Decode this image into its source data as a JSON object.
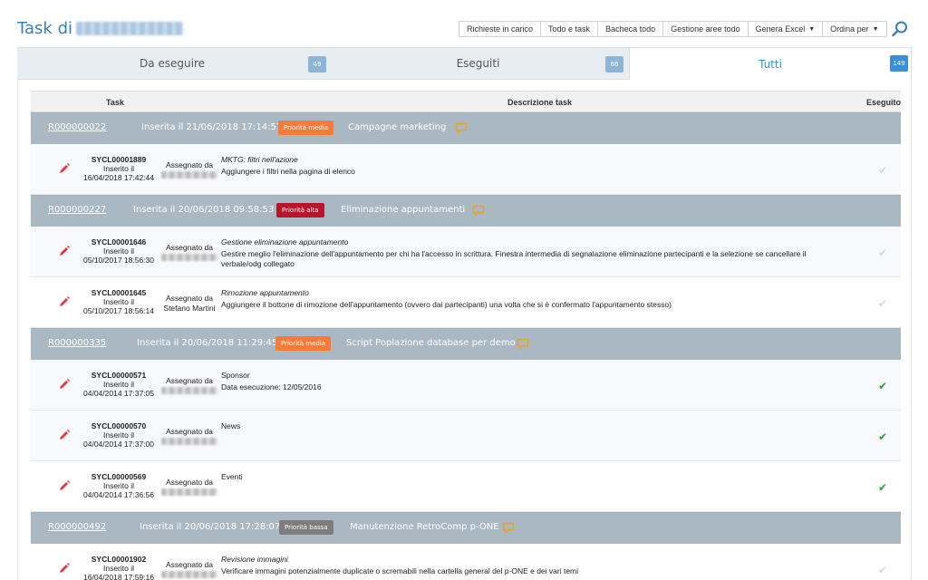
{
  "header": {
    "title_prefix": "Task di",
    "toolbar": [
      {
        "label": "Richieste in carico",
        "dropdown": false
      },
      {
        "label": "Todo e task",
        "dropdown": false
      },
      {
        "label": "Bacheca todo",
        "dropdown": false
      },
      {
        "label": "Gestione aree todo",
        "dropdown": false
      },
      {
        "label": "Genera Excel",
        "dropdown": true
      },
      {
        "label": "Ordina per",
        "dropdown": true
      }
    ],
    "search_icon": "search-icon"
  },
  "tabs": [
    {
      "label": "Da eseguire",
      "count": "49",
      "active": false
    },
    {
      "label": "Eseguiti",
      "count": "66",
      "active": false
    },
    {
      "label": "Tutti",
      "count": "149",
      "active": true
    }
  ],
  "table": {
    "headers": {
      "task": "Task",
      "description": "Descrizione task",
      "done": "Eseguito"
    },
    "groups": [
      {
        "code": "R000000022",
        "inserted": "Inserita il 21/06/2018 17:14:57",
        "priority": "Priorità media",
        "priority_level": "media",
        "title": "Campagne marketing",
        "tasks": [
          {
            "code": "SYCL00001889",
            "inserted_label": "Inserito il",
            "date": "16/04/2018 17:42:44",
            "assigned_label": "Assegnato da",
            "assigned_name": "",
            "desc_title": "MKTG: filtri nell'azione",
            "desc_title_italic": true,
            "desc_text": "Aggiungere i filtri nella pagina di elenco",
            "done": false
          }
        ]
      },
      {
        "code": "R000000227",
        "inserted": "Inserita il 20/06/2018 09:58:53",
        "priority": "Priorità alta",
        "priority_level": "alta",
        "title": "Eliminazione appuntamenti",
        "tasks": [
          {
            "code": "SYCL00001646",
            "inserted_label": "Inserito il",
            "date": "05/10/2017 18:56:30",
            "assigned_label": "Assegnato da",
            "assigned_name": "",
            "desc_title": "Gestione eliminazione appuntamento",
            "desc_title_italic": true,
            "desc_text": "Gestire meglio l'eliminazione dell'appuntamento per chi ha l'accesso in scrittura. Finestra intermedia di segnalazione eliminazione partecipanti e la selezione se cancellare il verbale/odg collegato",
            "done": false
          },
          {
            "code": "SYCL00001645",
            "inserted_label": "Inserito il",
            "date": "05/10/2017 18:56:14",
            "assigned_label": "Assegnato da",
            "assigned_name": "Stefano Martini",
            "desc_title": "Rimozione appuntamento",
            "desc_title_italic": true,
            "desc_text": "Aggiungere il bottone di rimozione dell'appuntamento (ovvero dai partecipanti) una volta che si è confermato l'appuntamento stesso)",
            "done": false
          }
        ]
      },
      {
        "code": "R000000335",
        "inserted": "Inserita il 20/06/2018 11:29:45",
        "priority": "Priorità media",
        "priority_level": "media",
        "title": "Script Poplazione database per demo",
        "tasks": [
          {
            "code": "SYCL00000571",
            "inserted_label": "Inserito il",
            "date": "04/04/2014 17:37:05",
            "assigned_label": "Assegnato da",
            "assigned_name": "",
            "desc_title": "Sponsor",
            "desc_title_italic": false,
            "desc_text": "Data esecuzione: 12/05/2016",
            "done": true
          },
          {
            "code": "SYCL00000570",
            "inserted_label": "Inserito il",
            "date": "04/04/2014 17:37:00",
            "assigned_label": "Assegnato da",
            "assigned_name": "",
            "desc_title": "News",
            "desc_title_italic": false,
            "desc_text": "",
            "done": true
          },
          {
            "code": "SYCL00000569",
            "inserted_label": "Inserito il",
            "date": "04/04/2014 17:36:56",
            "assigned_label": "Assegnato da",
            "assigned_name": "",
            "desc_title": "Eventi",
            "desc_title_italic": false,
            "desc_text": "",
            "done": true
          }
        ]
      },
      {
        "code": "R000000492",
        "inserted": "Inserita il 20/06/2018 17:28:07",
        "priority": "Priorità bassa",
        "priority_level": "bassa",
        "title": "Manutenzione RetroComp p-ONE",
        "tasks": [
          {
            "code": "SYCL00001902",
            "inserted_label": "Inserito il",
            "date": "16/04/2018 17:59:16",
            "assigned_label": "Assegnato da",
            "assigned_name": "",
            "desc_title": "Revisione immagini",
            "desc_title_italic": true,
            "desc_text": "Verificare immagini potenzialmente duplicate o scremabili nella cartella general del p-ONE e dei vari temi",
            "done": false
          }
        ]
      }
    ]
  },
  "colors": {
    "accent": "#3a8fd6",
    "group_header": "#aab8c4",
    "priority_media": "#f47b38",
    "priority_alta": "#b8142b",
    "priority_bassa": "#7d7d7d",
    "done_check": "#2aa42a",
    "pending_check": "#d5d9dd",
    "edit_icon": "#e0383e"
  }
}
